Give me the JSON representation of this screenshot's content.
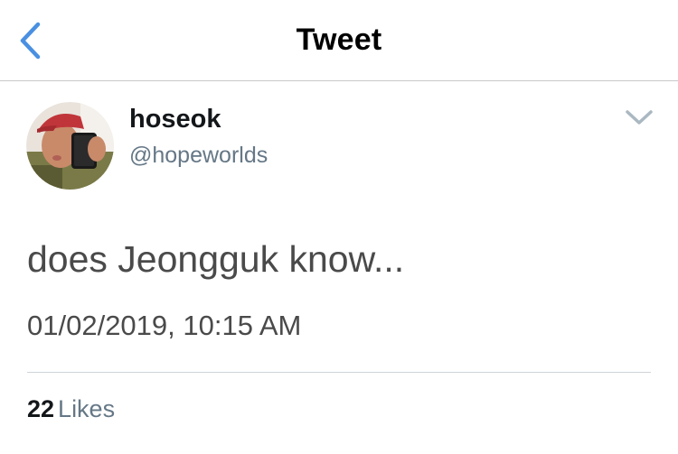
{
  "header": {
    "title": "Tweet",
    "back_icon": "chevron-left-icon",
    "accent_color": "#4a90e2"
  },
  "tweet": {
    "author": {
      "display_name": "hoseok",
      "username": "@hopeworlds",
      "avatar_icon": "avatar"
    },
    "menu_icon": "chevron-down-icon",
    "text": "does Jeongguk know...",
    "timestamp": "01/02/2019, 10:15 AM",
    "stats": {
      "likes_count": "22",
      "likes_label": "Likes"
    }
  }
}
